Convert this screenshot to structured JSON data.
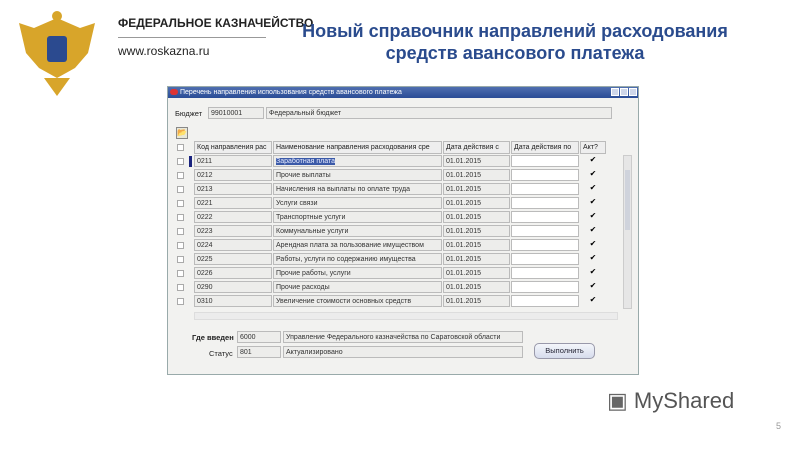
{
  "header": {
    "org": "ФЕДЕРАЛЬНОЕ КАЗНАЧЕЙСТВО",
    "url": "www.roskazna.ru",
    "title": "Новый справочник направлений расходования средств авансового платежа"
  },
  "window": {
    "title": "Перечень направления использования средств авансового платежа",
    "budget_label": "Бюджет",
    "budget_code": "99010001",
    "budget_name": "Федеральный бюджет",
    "columns": [
      "Код направления рас",
      "Наименование направления расходования сре",
      "Дата действия с",
      "Дата действия по",
      "Акт?"
    ],
    "rows": [
      {
        "code": "0211",
        "name": "Заработная плата",
        "from": "01.01.2015",
        "to": "",
        "active": "✔"
      },
      {
        "code": "0212",
        "name": "Прочие выплаты",
        "from": "01.01.2015",
        "to": "",
        "active": "✔"
      },
      {
        "code": "0213",
        "name": "Начисления на выплаты по оплате труда",
        "from": "01.01.2015",
        "to": "",
        "active": "✔"
      },
      {
        "code": "0221",
        "name": "Услуги связи",
        "from": "01.01.2015",
        "to": "",
        "active": "✔"
      },
      {
        "code": "0222",
        "name": "Транспортные услуги",
        "from": "01.01.2015",
        "to": "",
        "active": "✔"
      },
      {
        "code": "0223",
        "name": "Коммунальные услуги",
        "from": "01.01.2015",
        "to": "",
        "active": "✔"
      },
      {
        "code": "0224",
        "name": "Арендная плата за пользование имуществом",
        "from": "01.01.2015",
        "to": "",
        "active": "✔"
      },
      {
        "code": "0225",
        "name": "Работы, услуги по содержанию имущества",
        "from": "01.01.2015",
        "to": "",
        "active": "✔"
      },
      {
        "code": "0226",
        "name": "Прочие работы, услуги",
        "from": "01.01.2015",
        "to": "",
        "active": "✔"
      },
      {
        "code": "0290",
        "name": "Прочие расходы",
        "from": "01.01.2015",
        "to": "",
        "active": "✔"
      },
      {
        "code": "0310",
        "name": "Увеличение стоимости основных средств",
        "from": "01.01.2015",
        "to": "",
        "active": "✔"
      }
    ],
    "where_label": "Где введен",
    "where_code": "6000",
    "where_name": "Управление Федерального казначейства по Саратовской области",
    "status_label": "Статус",
    "status_code": "801",
    "status_name": "Актуализировано",
    "execute_label": "Выполнить"
  },
  "footer": {
    "logo": "MyShared",
    "page": "5"
  }
}
